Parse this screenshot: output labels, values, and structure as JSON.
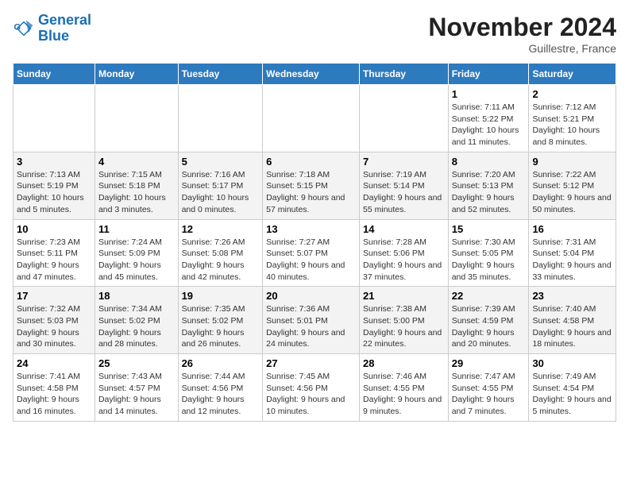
{
  "header": {
    "logo_line1": "General",
    "logo_line2": "Blue",
    "month_title": "November 2024",
    "location": "Guillestre, France"
  },
  "days_of_week": [
    "Sunday",
    "Monday",
    "Tuesday",
    "Wednesday",
    "Thursday",
    "Friday",
    "Saturday"
  ],
  "weeks": [
    [
      {
        "num": "",
        "info": ""
      },
      {
        "num": "",
        "info": ""
      },
      {
        "num": "",
        "info": ""
      },
      {
        "num": "",
        "info": ""
      },
      {
        "num": "",
        "info": ""
      },
      {
        "num": "1",
        "info": "Sunrise: 7:11 AM\nSunset: 5:22 PM\nDaylight: 10 hours and 11 minutes."
      },
      {
        "num": "2",
        "info": "Sunrise: 7:12 AM\nSunset: 5:21 PM\nDaylight: 10 hours and 8 minutes."
      }
    ],
    [
      {
        "num": "3",
        "info": "Sunrise: 7:13 AM\nSunset: 5:19 PM\nDaylight: 10 hours and 5 minutes."
      },
      {
        "num": "4",
        "info": "Sunrise: 7:15 AM\nSunset: 5:18 PM\nDaylight: 10 hours and 3 minutes."
      },
      {
        "num": "5",
        "info": "Sunrise: 7:16 AM\nSunset: 5:17 PM\nDaylight: 10 hours and 0 minutes."
      },
      {
        "num": "6",
        "info": "Sunrise: 7:18 AM\nSunset: 5:15 PM\nDaylight: 9 hours and 57 minutes."
      },
      {
        "num": "7",
        "info": "Sunrise: 7:19 AM\nSunset: 5:14 PM\nDaylight: 9 hours and 55 minutes."
      },
      {
        "num": "8",
        "info": "Sunrise: 7:20 AM\nSunset: 5:13 PM\nDaylight: 9 hours and 52 minutes."
      },
      {
        "num": "9",
        "info": "Sunrise: 7:22 AM\nSunset: 5:12 PM\nDaylight: 9 hours and 50 minutes."
      }
    ],
    [
      {
        "num": "10",
        "info": "Sunrise: 7:23 AM\nSunset: 5:11 PM\nDaylight: 9 hours and 47 minutes."
      },
      {
        "num": "11",
        "info": "Sunrise: 7:24 AM\nSunset: 5:09 PM\nDaylight: 9 hours and 45 minutes."
      },
      {
        "num": "12",
        "info": "Sunrise: 7:26 AM\nSunset: 5:08 PM\nDaylight: 9 hours and 42 minutes."
      },
      {
        "num": "13",
        "info": "Sunrise: 7:27 AM\nSunset: 5:07 PM\nDaylight: 9 hours and 40 minutes."
      },
      {
        "num": "14",
        "info": "Sunrise: 7:28 AM\nSunset: 5:06 PM\nDaylight: 9 hours and 37 minutes."
      },
      {
        "num": "15",
        "info": "Sunrise: 7:30 AM\nSunset: 5:05 PM\nDaylight: 9 hours and 35 minutes."
      },
      {
        "num": "16",
        "info": "Sunrise: 7:31 AM\nSunset: 5:04 PM\nDaylight: 9 hours and 33 minutes."
      }
    ],
    [
      {
        "num": "17",
        "info": "Sunrise: 7:32 AM\nSunset: 5:03 PM\nDaylight: 9 hours and 30 minutes."
      },
      {
        "num": "18",
        "info": "Sunrise: 7:34 AM\nSunset: 5:02 PM\nDaylight: 9 hours and 28 minutes."
      },
      {
        "num": "19",
        "info": "Sunrise: 7:35 AM\nSunset: 5:02 PM\nDaylight: 9 hours and 26 minutes."
      },
      {
        "num": "20",
        "info": "Sunrise: 7:36 AM\nSunset: 5:01 PM\nDaylight: 9 hours and 24 minutes."
      },
      {
        "num": "21",
        "info": "Sunrise: 7:38 AM\nSunset: 5:00 PM\nDaylight: 9 hours and 22 minutes."
      },
      {
        "num": "22",
        "info": "Sunrise: 7:39 AM\nSunset: 4:59 PM\nDaylight: 9 hours and 20 minutes."
      },
      {
        "num": "23",
        "info": "Sunrise: 7:40 AM\nSunset: 4:58 PM\nDaylight: 9 hours and 18 minutes."
      }
    ],
    [
      {
        "num": "24",
        "info": "Sunrise: 7:41 AM\nSunset: 4:58 PM\nDaylight: 9 hours and 16 minutes."
      },
      {
        "num": "25",
        "info": "Sunrise: 7:43 AM\nSunset: 4:57 PM\nDaylight: 9 hours and 14 minutes."
      },
      {
        "num": "26",
        "info": "Sunrise: 7:44 AM\nSunset: 4:56 PM\nDaylight: 9 hours and 12 minutes."
      },
      {
        "num": "27",
        "info": "Sunrise: 7:45 AM\nSunset: 4:56 PM\nDaylight: 9 hours and 10 minutes."
      },
      {
        "num": "28",
        "info": "Sunrise: 7:46 AM\nSunset: 4:55 PM\nDaylight: 9 hours and 9 minutes."
      },
      {
        "num": "29",
        "info": "Sunrise: 7:47 AM\nSunset: 4:55 PM\nDaylight: 9 hours and 7 minutes."
      },
      {
        "num": "30",
        "info": "Sunrise: 7:49 AM\nSunset: 4:54 PM\nDaylight: 9 hours and 5 minutes."
      }
    ]
  ]
}
